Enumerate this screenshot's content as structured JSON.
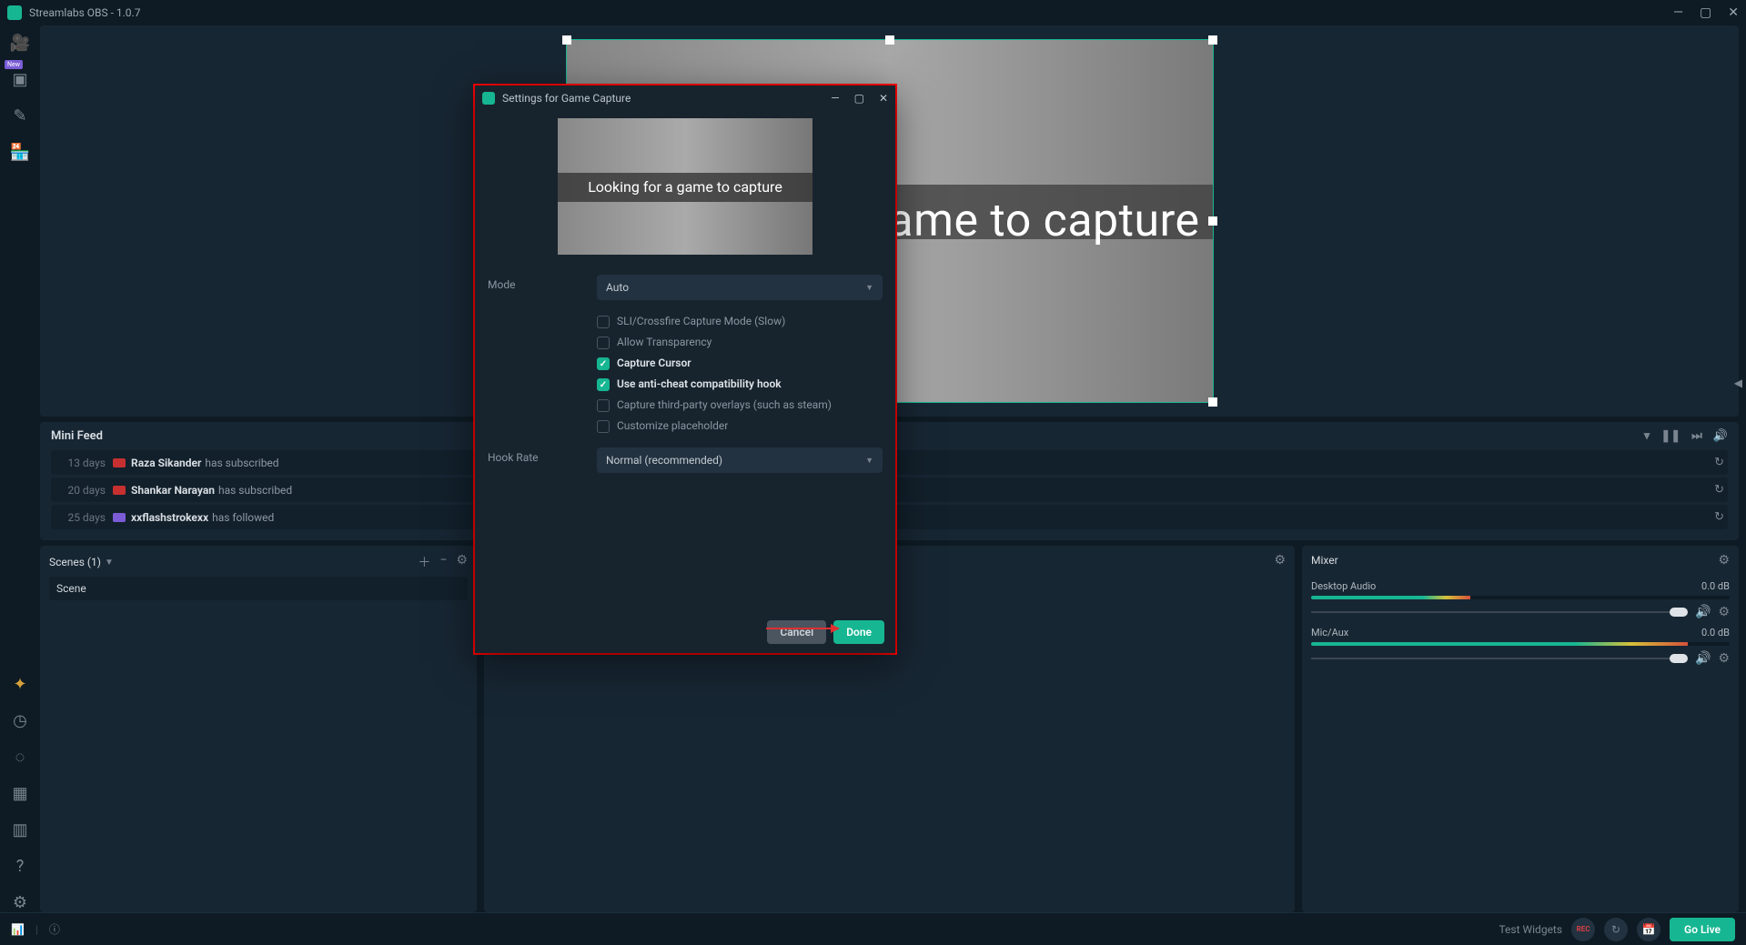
{
  "window": {
    "title": "Streamlabs OBS - 1.0.7"
  },
  "preview": {
    "caption": "Looking for a game to capture"
  },
  "mini_feed": {
    "title": "Mini Feed",
    "rows": [
      {
        "time": "13 days",
        "platform": "youtube",
        "user": "Raza Sikander",
        "action": "has subscribed"
      },
      {
        "time": "20 days",
        "platform": "youtube",
        "user": "Shankar Narayan",
        "action": "has subscribed"
      },
      {
        "time": "25 days",
        "platform": "twitch",
        "user": "xxflashstrokexx",
        "action": "has followed"
      }
    ]
  },
  "scenes": {
    "title": "Scenes (1)",
    "items": [
      "Scene"
    ]
  },
  "mixer": {
    "title": "Mixer",
    "channels": [
      {
        "name": "Desktop Audio",
        "db": "0.0 dB",
        "level": 38
      },
      {
        "name": "Mic/Aux",
        "db": "0.0 dB",
        "level": 90
      }
    ]
  },
  "footer": {
    "test_widgets": "Test Widgets",
    "rec": "REC",
    "go_live": "Go Live"
  },
  "modal": {
    "title": "Settings for Game Capture",
    "preview_caption": "Looking for a game to capture",
    "mode_label": "Mode",
    "mode_value": "Auto",
    "checkboxes": [
      {
        "label": "SLI/Crossfire Capture Mode (Slow)",
        "checked": false
      },
      {
        "label": "Allow Transparency",
        "checked": false
      },
      {
        "label": "Capture Cursor",
        "checked": true
      },
      {
        "label": "Use anti-cheat compatibility hook",
        "checked": true
      },
      {
        "label": "Capture third-party overlays (such as steam)",
        "checked": false
      },
      {
        "label": "Customize placeholder",
        "checked": false
      }
    ],
    "hook_rate_label": "Hook Rate",
    "hook_rate_value": "Normal (recommended)",
    "cancel": "Cancel",
    "done": "Done"
  }
}
